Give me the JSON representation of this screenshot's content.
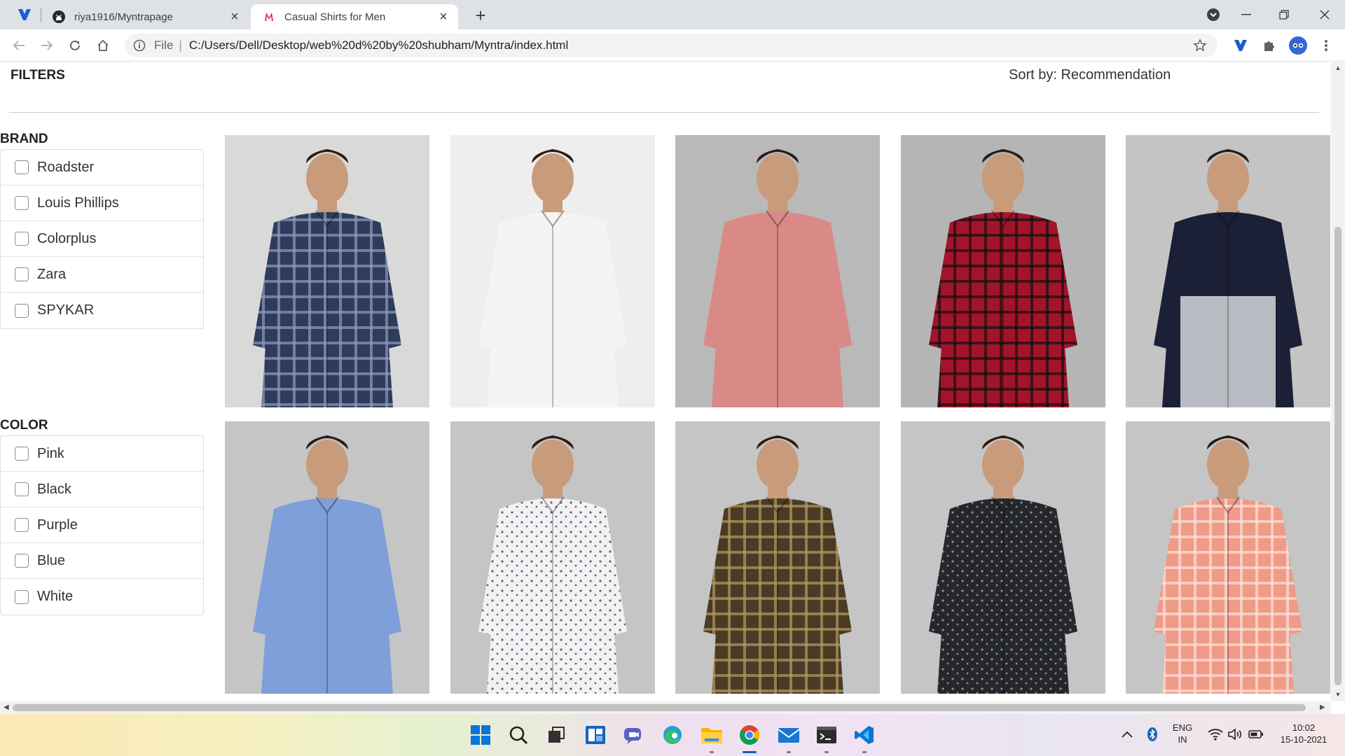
{
  "browser": {
    "tabs": [
      {
        "title": "riya1916/Myntrapage",
        "favicon": "github-icon",
        "active": false
      },
      {
        "title": "Casual Shirts for Men",
        "favicon": "myntra-icon",
        "active": true
      }
    ],
    "address": {
      "protocol_label": "File",
      "url": "C:/Users/Dell/Desktop/web%20d%20by%20shubham/Myntra/index.html"
    }
  },
  "page": {
    "filters_title": "FILTERS",
    "sort_label": "Sort by: Recommendation",
    "brand": {
      "title": "BRAND",
      "options": [
        "Roadster",
        "Louis Phillips",
        "Colorplus",
        "Zara",
        "SPYKAR"
      ]
    },
    "color": {
      "title": "COLOR",
      "options": [
        "Pink",
        "Black",
        "Purple",
        "Blue",
        "White"
      ]
    },
    "products": [
      {
        "shirt": "navy-check",
        "bg": "#d9d9d9"
      },
      {
        "shirt": "white-plain",
        "bg": "#eeeeee"
      },
      {
        "shirt": "pink-plain",
        "bg": "#b9b9b9"
      },
      {
        "shirt": "red-check",
        "bg": "#b5b5b5"
      },
      {
        "shirt": "navy-grey-colorblock",
        "bg": "#c4c4c4"
      },
      {
        "shirt": "blue-plain",
        "bg": "#c5c5c5"
      },
      {
        "shirt": "white-print",
        "bg": "#c5c5c5"
      },
      {
        "shirt": "brown-check",
        "bg": "#c5c5c5"
      },
      {
        "shirt": "black-floral",
        "bg": "#c5c5c5"
      },
      {
        "shirt": "peach-check",
        "bg": "#c5c5c5"
      }
    ]
  },
  "taskbar": {
    "lang_top": "ENG",
    "lang_bottom": "IN",
    "time": "10:02",
    "date": "15-10-2021"
  }
}
